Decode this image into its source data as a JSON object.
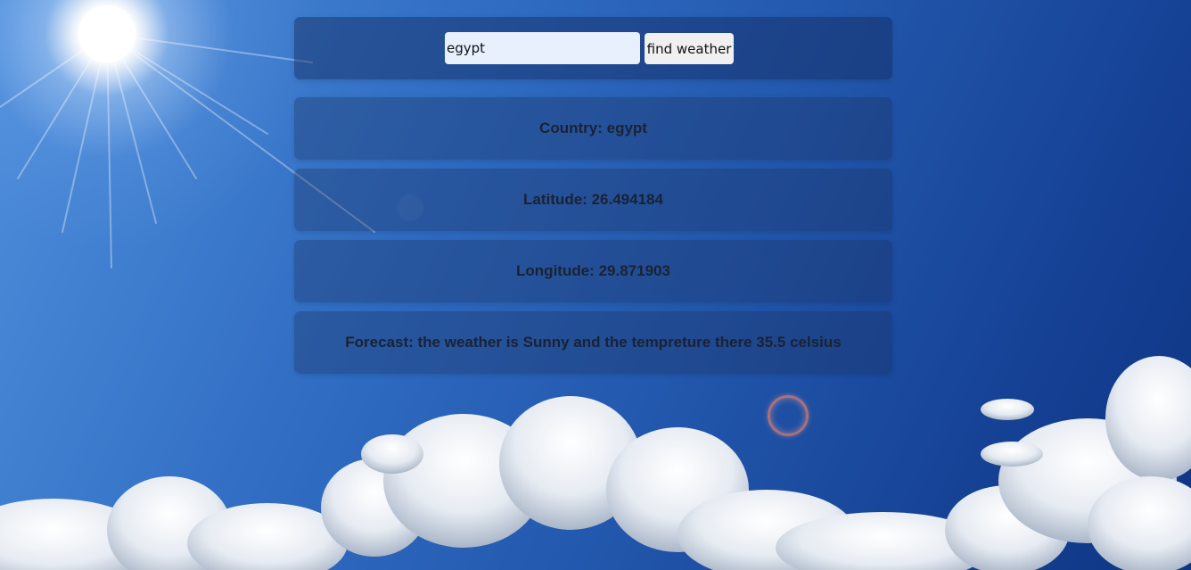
{
  "search": {
    "value": "egypt",
    "button_label": "find weather"
  },
  "results": {
    "country_label": "Country:",
    "country": "egypt",
    "latitude_label": "Latitude:",
    "latitude": "26.494184",
    "longitude_label": "Longitude:",
    "longitude": "29.871903",
    "forecast_label": "Forecast:",
    "forecast": "the weather is Sunny and the tempreture there 35.5 celsius"
  }
}
